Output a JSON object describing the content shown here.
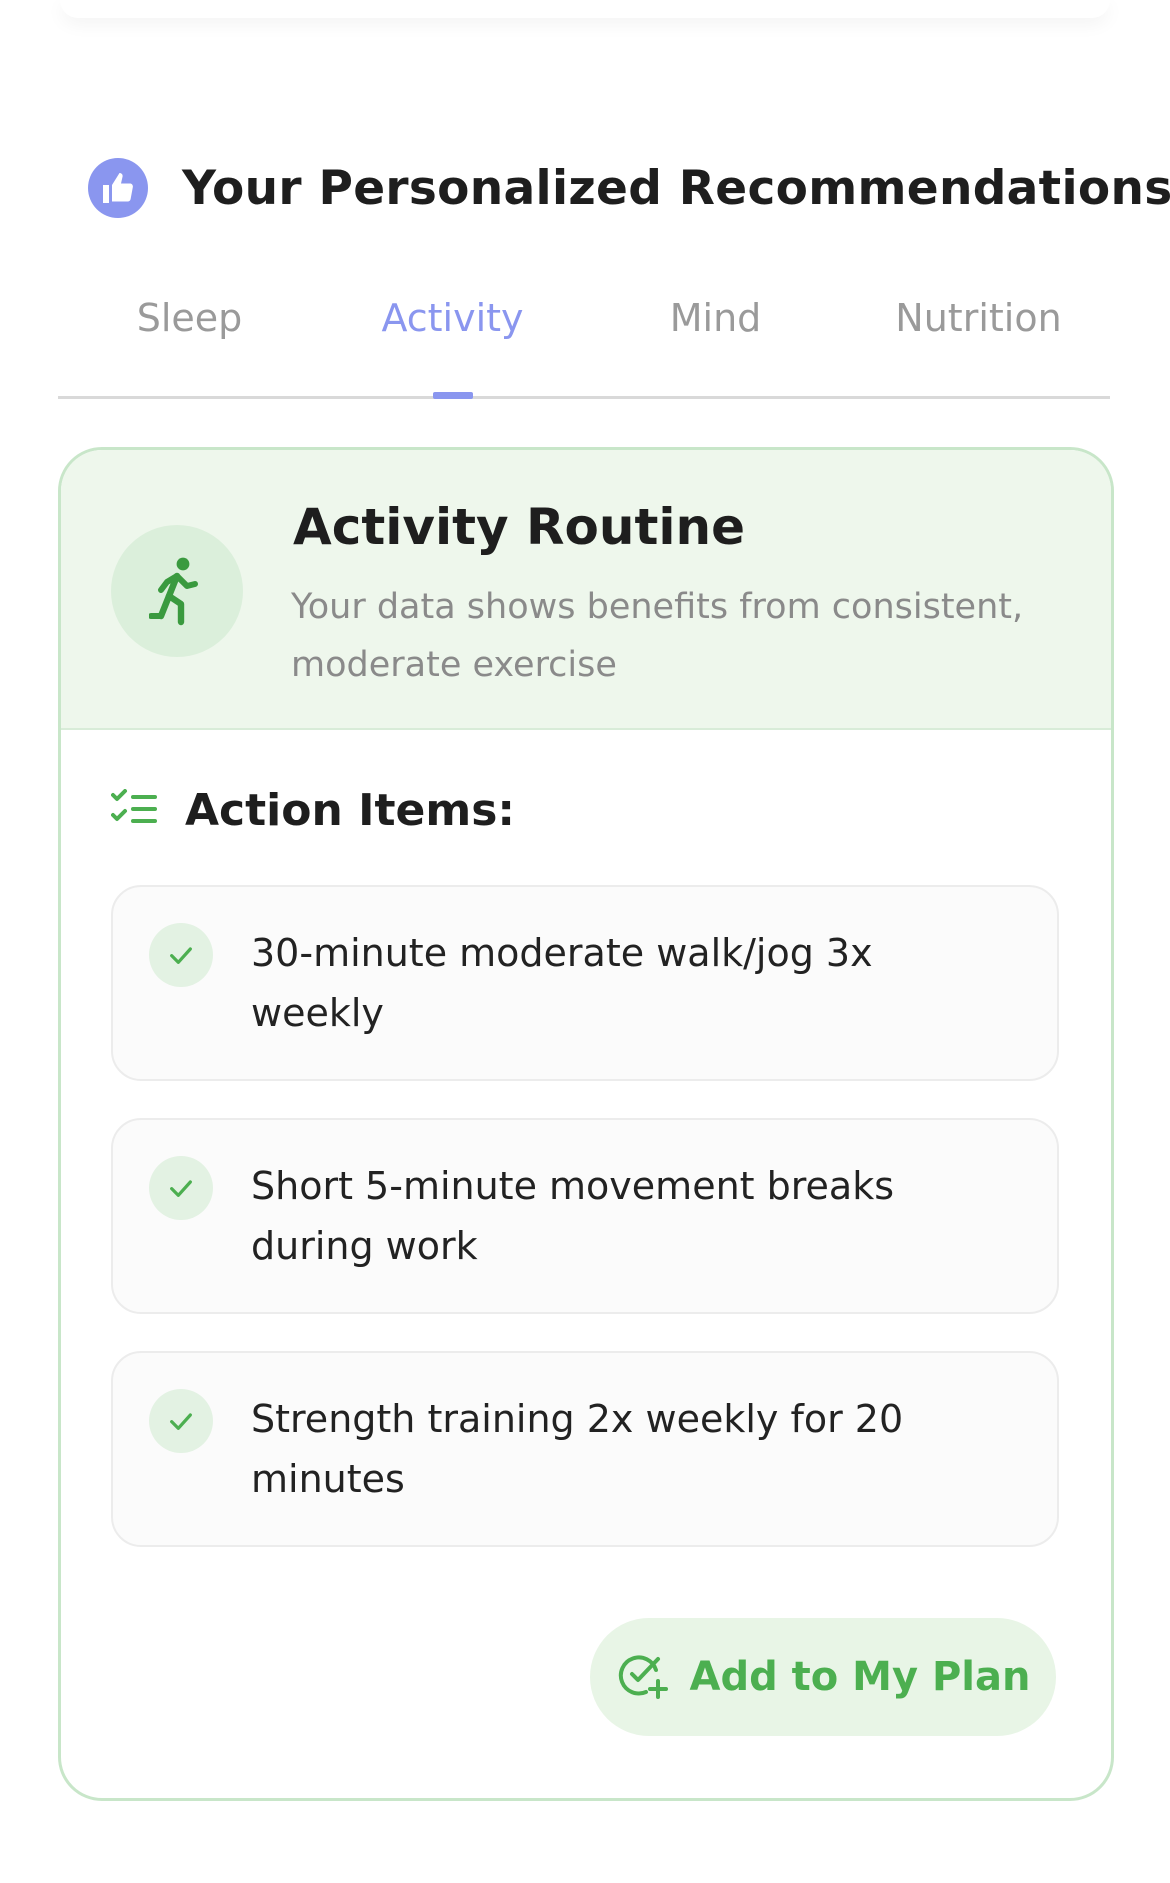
{
  "header": {
    "title": "Your Personalized Recommendations",
    "icon": "thumbs-up-icon",
    "icon_color": "#8a96ef"
  },
  "tabs": [
    {
      "label": "Sleep",
      "active": false
    },
    {
      "label": "Activity",
      "active": true
    },
    {
      "label": "Mind",
      "active": false
    },
    {
      "label": "Nutrition",
      "active": false
    }
  ],
  "card": {
    "icon": "running-icon",
    "title": "Activity Routine",
    "description": "Your data shows benefits from consistent, moderate exercise",
    "action_items_title": "Action Items:",
    "action_items": [
      {
        "text": "30-minute moderate walk/jog 3x weekly"
      },
      {
        "text": "Short 5-minute movement breaks during work"
      },
      {
        "text": "Strength training 2x weekly for 20 minutes"
      }
    ],
    "add_button_label": "Add to My Plan"
  },
  "colors": {
    "accent": "#8a96ef",
    "green": "#4caf50",
    "card_border": "#c8e6c9",
    "card_header_bg": "#eef7ec"
  }
}
